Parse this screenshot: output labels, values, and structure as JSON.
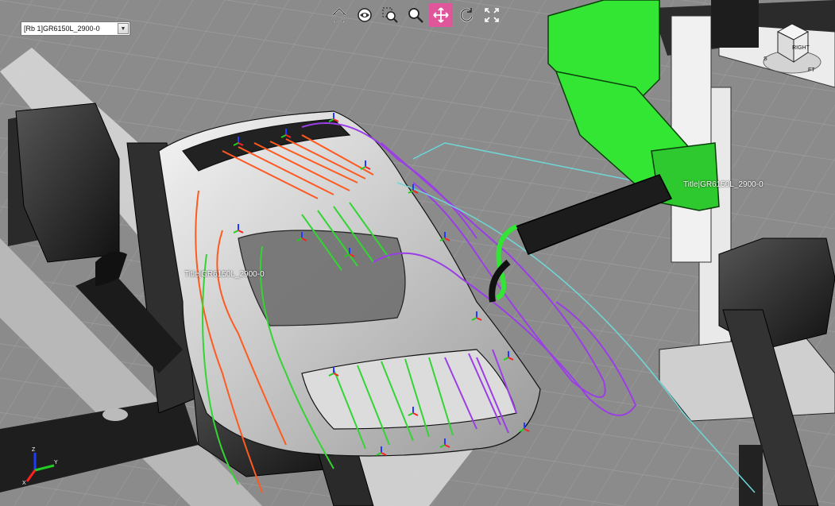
{
  "robot_selector": {
    "value": "[Rb 1]GR6150L_2900-0"
  },
  "toolbar": {
    "tools": [
      {
        "name": "home-icon",
        "label": "Home view"
      },
      {
        "name": "look-icon",
        "label": "Look at"
      },
      {
        "name": "zoom-window-icon",
        "label": "Zoom window"
      },
      {
        "name": "zoom-icon",
        "label": "Zoom"
      },
      {
        "name": "pan-icon",
        "label": "Pan",
        "active": true
      },
      {
        "name": "rotate-icon",
        "label": "Rotate"
      },
      {
        "name": "fit-icon",
        "label": "Fit all"
      }
    ],
    "active_color": "#e0569b"
  },
  "scene_labels": {
    "robot_right": "Title|GR6150L_2900-0",
    "robot_left": "Title|GR6150L_2900-0"
  },
  "viewcube": {
    "face": "RIGHT",
    "front": "FT",
    "side": "S"
  },
  "triad": {
    "x": "X",
    "y": "Y",
    "z": "Z"
  },
  "colors": {
    "path_orange": "#ff5a1f",
    "path_green": "#33d433",
    "path_purple": "#9b3ee6",
    "path_cyan": "#6fd6d6",
    "robot_highlight": "#33e633",
    "floor": "#8a8a8a"
  }
}
